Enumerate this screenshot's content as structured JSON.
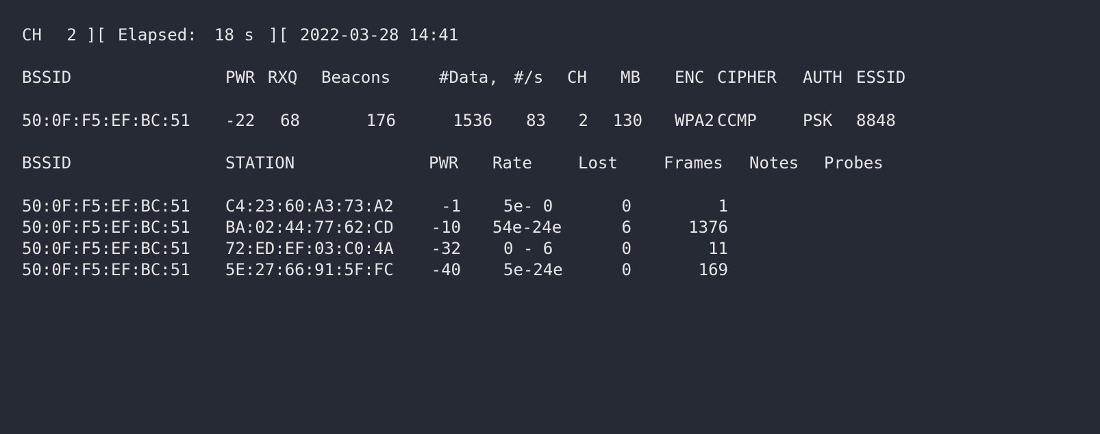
{
  "status": {
    "channel_label": "CH",
    "channel": "2",
    "elapsed_label": "Elapsed:",
    "elapsed": "18 s",
    "datetime": "2022-03-28 14:41",
    "sep1": "][",
    "sep2": "]["
  },
  "ap_table": {
    "headers": {
      "bssid": "BSSID",
      "pwr": "PWR",
      "rxq": "RXQ",
      "beacons": "Beacons",
      "data": "#Data,",
      "rate": "#/s",
      "ch": "CH",
      "mb": "MB",
      "enc": "ENC",
      "cipher": "CIPHER",
      "auth": "AUTH",
      "essid": "ESSID"
    },
    "rows": [
      {
        "bssid": "50:0F:F5:EF:BC:51",
        "pwr": "-22",
        "rxq": "68",
        "beacons": "176",
        "data": "1536",
        "rate": "83",
        "ch": "2",
        "mb": "130",
        "enc": "WPA2",
        "cipher": "CCMP",
        "auth": "PSK",
        "essid": "8848"
      }
    ]
  },
  "station_table": {
    "headers": {
      "bssid": "BSSID",
      "station": "STATION",
      "pwr": "PWR",
      "rate": "Rate",
      "lost": "Lost",
      "frames": "Frames",
      "notes": "Notes",
      "probes": "Probes"
    },
    "rows": [
      {
        "bssid": "50:0F:F5:EF:BC:51",
        "station": "C4:23:60:A3:73:A2",
        "pwr": "-1",
        "rate": "5e- 0",
        "lost": "0",
        "frames": "1"
      },
      {
        "bssid": "50:0F:F5:EF:BC:51",
        "station": "BA:02:44:77:62:CD",
        "pwr": "-10",
        "rate": "54e-24e",
        "lost": "6",
        "frames": "1376"
      },
      {
        "bssid": "50:0F:F5:EF:BC:51",
        "station": "72:ED:EF:03:C0:4A",
        "pwr": "-32",
        "rate": "0 - 6",
        "lost": "0",
        "frames": "11"
      },
      {
        "bssid": "50:0F:F5:EF:BC:51",
        "station": "5E:27:66:91:5F:FC",
        "pwr": "-40",
        "rate": "5e-24e",
        "lost": "0",
        "frames": "169"
      }
    ]
  }
}
